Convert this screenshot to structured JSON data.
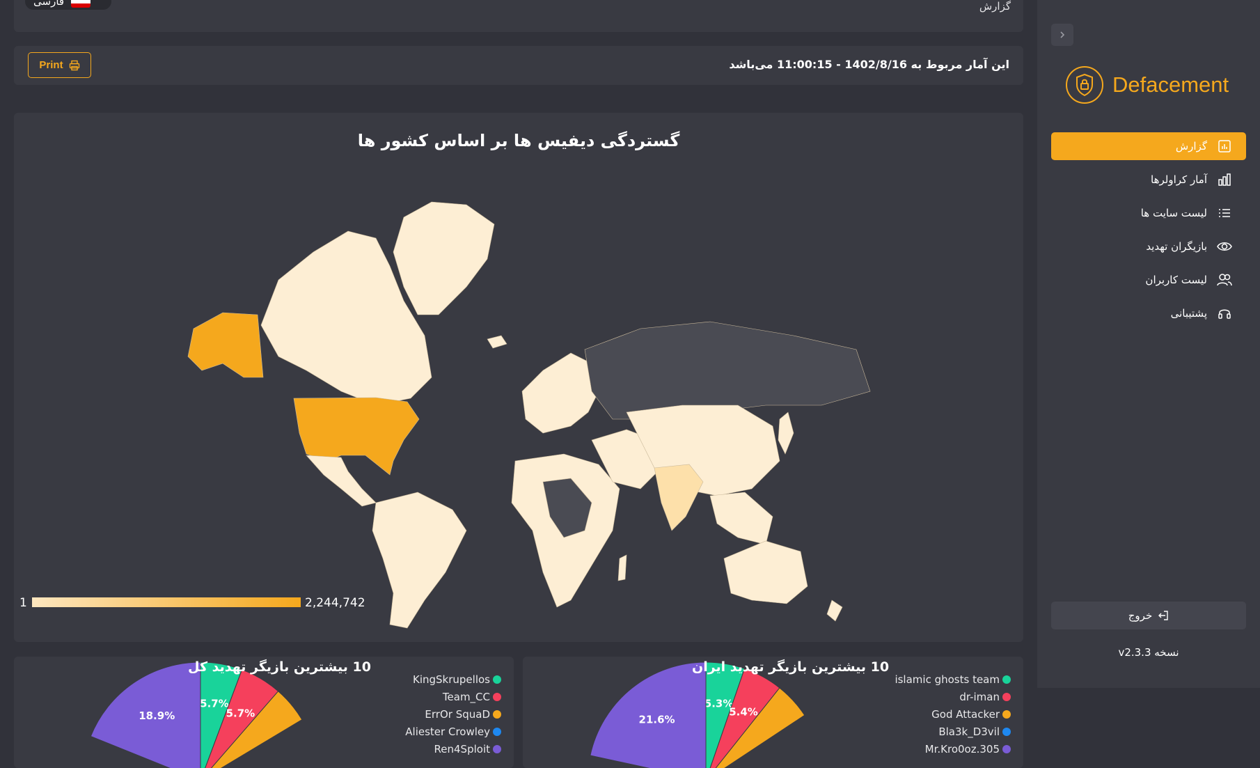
{
  "topbar": {
    "language_label": "فارسی",
    "breadcrumb": "گزارش"
  },
  "infobar": {
    "print_label": "Print",
    "info_text": "این آمار مربوط به 1402/8/16 - 11:00:15 می‌باشد"
  },
  "map": {
    "title": "گستردگی دیفیس ها بر اساس کشور ها",
    "legend_min": "1",
    "legend_max": "2,244,742",
    "colors": {
      "low": "#fdeed4",
      "high": "#f5a81d",
      "no_data": "#4a4b53",
      "background": "#393a42"
    }
  },
  "pie_global": {
    "title": "10 بیشترین بازیگر تهدید کل",
    "legend": [
      {
        "name": "KingSkrupellos",
        "color": "#19d39a"
      },
      {
        "name": "Team_CC",
        "color": "#f5405c"
      },
      {
        "name": "ErrOr SquaD",
        "color": "#f5a81d"
      },
      {
        "name": "Aliester Crowley",
        "color": "#1e88f0"
      },
      {
        "name": "Ren4Sploit",
        "color": "#7a5cd6"
      }
    ],
    "slices": [
      {
        "label": "5.7%",
        "value": 5.7,
        "color": "#19d39a"
      },
      {
        "label": "5.7%",
        "value": 5.7,
        "color": "#f5405c"
      },
      {
        "label": "",
        "value": 5.0,
        "color": "#f5a81d"
      },
      {
        "label": "18.9%",
        "value": 18.9,
        "color": "#7a5cd6"
      }
    ]
  },
  "pie_iran": {
    "title": "10 بیشترین بازیگر تهدید ایران",
    "legend": [
      {
        "name": "islamic ghosts team",
        "color": "#19d39a"
      },
      {
        "name": "dr-iman",
        "color": "#f5405c"
      },
      {
        "name": "God Attacker",
        "color": "#f5a81d"
      },
      {
        "name": "Bla3k_D3vil",
        "color": "#1e88f0"
      },
      {
        "name": "Mr.Kro0oz.305",
        "color": "#7a5cd6"
      }
    ],
    "slices": [
      {
        "label": "5.3%",
        "value": 5.3,
        "color": "#19d39a"
      },
      {
        "label": "5.4%",
        "value": 5.4,
        "color": "#f5405c"
      },
      {
        "label": "",
        "value": 5.0,
        "color": "#f5a81d"
      },
      {
        "label": "21.6%",
        "value": 21.6,
        "color": "#7a5cd6"
      }
    ]
  },
  "sidebar": {
    "brand": "Defacement",
    "items": [
      {
        "label": "گزارش",
        "icon": "report-icon",
        "active": true
      },
      {
        "label": "آمار کراولرها",
        "icon": "bar-chart-icon",
        "active": false
      },
      {
        "label": "لیست سایت ها",
        "icon": "list-icon",
        "active": false
      },
      {
        "label": "بازیگران تهدید",
        "icon": "eye-icon",
        "active": false
      },
      {
        "label": "لیست کاربران",
        "icon": "users-icon",
        "active": false
      },
      {
        "label": "پشتیبانی",
        "icon": "headset-icon",
        "active": false
      }
    ],
    "logout_label": "خروج",
    "version": "نسخه v2.3.3"
  }
}
